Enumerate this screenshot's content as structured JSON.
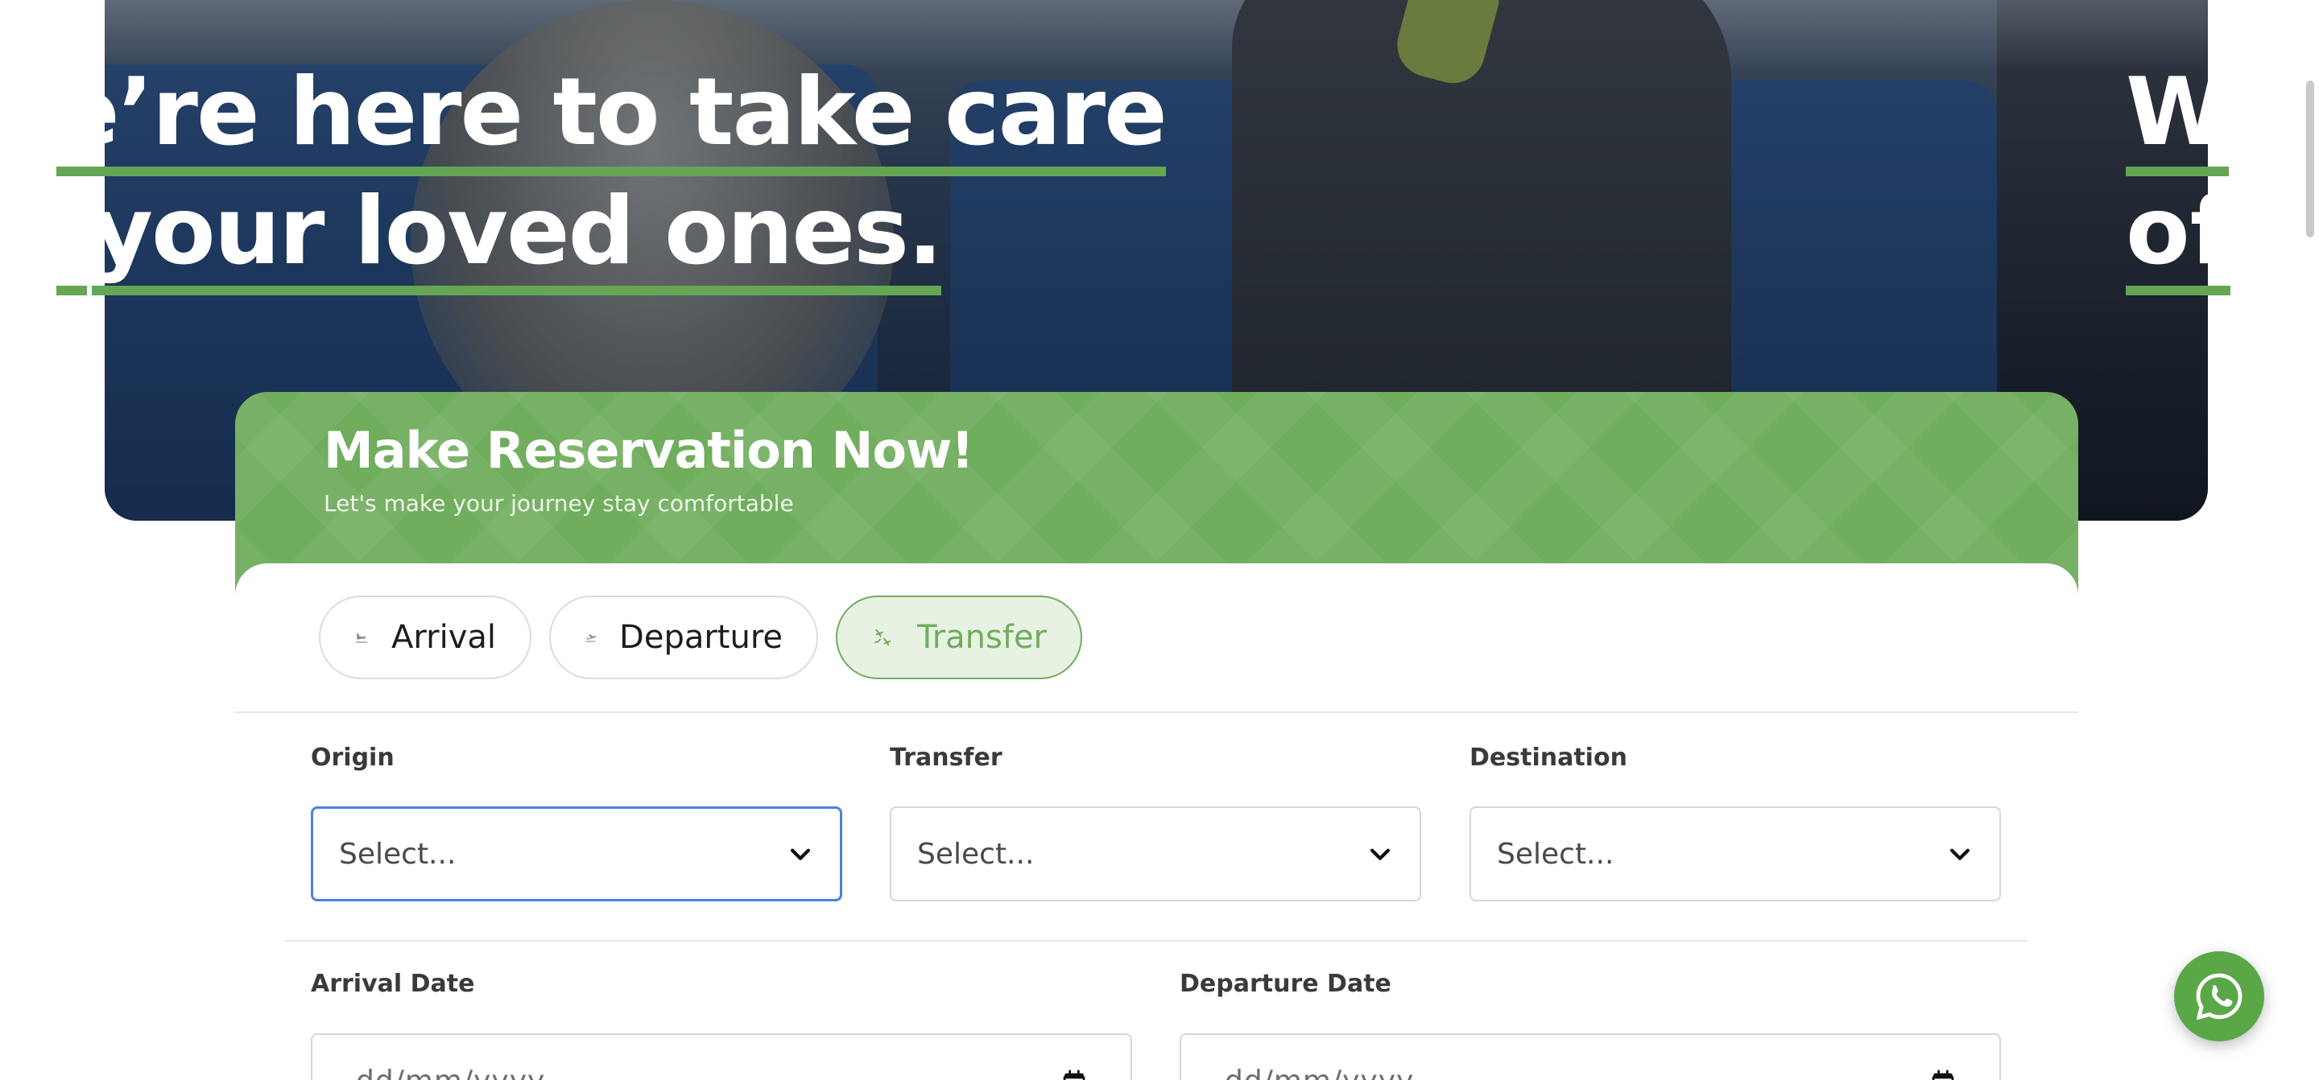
{
  "hero": {
    "slide_main_line1": "e’re here to take care",
    "slide_main_line2": "your loved ones.",
    "slide_main_line2_fragment": ".",
    "slide_next_line1": "W",
    "slide_next_line2": "of"
  },
  "reservation": {
    "title": "Make Reservation Now!",
    "subtitle": "Let's make your journey stay comfortable",
    "tabs": [
      {
        "label": "Arrival",
        "icon": "plane-landing-icon",
        "active": false
      },
      {
        "label": "Departure",
        "icon": "plane-takeoff-icon",
        "active": false
      },
      {
        "label": "Transfer",
        "icon": "plane-transfer-icon",
        "active": true
      }
    ],
    "fields": {
      "origin": {
        "label": "Origin",
        "placeholder": "Select..."
      },
      "transfer": {
        "label": "Transfer",
        "placeholder": "Select..."
      },
      "destination": {
        "label": "Destination",
        "placeholder": "Select..."
      },
      "arrival_date": {
        "label": "Arrival Date",
        "placeholder": "dd/mm/yyyy"
      },
      "departure_date": {
        "label": "Departure Date",
        "placeholder": "dd/mm/yyyy"
      }
    }
  },
  "colors": {
    "brand_green": "#70ad5d",
    "underline_green": "#65a654",
    "focus_blue": "#4a80e2",
    "whatsapp_green": "#5aa748"
  },
  "floating": {
    "whatsapp_icon": "whatsapp-icon"
  }
}
